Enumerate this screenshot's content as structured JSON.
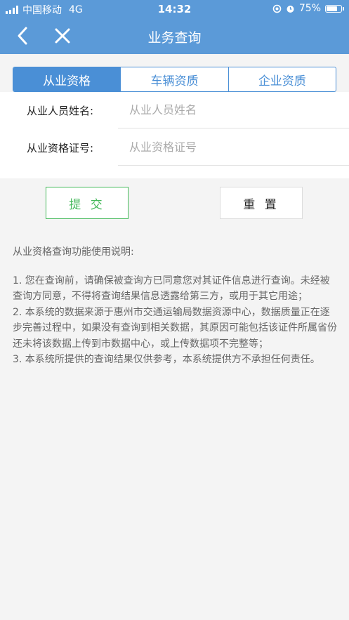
{
  "status_bar": {
    "carrier": "中国移动",
    "network": "4G",
    "time": "14:32",
    "battery": "75%"
  },
  "nav": {
    "title": "业务查询",
    "back_icon": "chevron-left-icon",
    "close_icon": "close-icon"
  },
  "tabs": [
    {
      "label": "从业资格",
      "active": true
    },
    {
      "label": "车辆资质",
      "active": false
    },
    {
      "label": "企业资质",
      "active": false
    }
  ],
  "form": {
    "name": {
      "label": "从业人员姓名:",
      "placeholder": "从业人员姓名",
      "value": ""
    },
    "cert": {
      "label": "从业资格证号:",
      "placeholder": "从业资格证号",
      "value": ""
    }
  },
  "buttons": {
    "submit": "提 交",
    "reset": "重 置"
  },
  "instructions": {
    "heading": "从业资格查询功能使用说明:",
    "items": [
      "1. 您在查询前，请确保被查询方已同意您对其证件信息进行查询。未经被查询方同意，不得将查询结果信息透露给第三方，或用于其它用途；",
      "2. 本系统的数据来源于惠州市交通运输局数据资源中心，数据质量正在逐步完善过程中，如果没有查询到相关数据，其原因可能包括该证件所属省份还未将该数据上传到市数据中心，或上传数据项不完整等；",
      "3. 本系统所提供的查询结果仅供参考，本系统提供方不承担任何责任。"
    ]
  },
  "colors": {
    "header": "#5b9ad8",
    "tab_accent": "#4a8fd6",
    "submit": "#44b95a"
  }
}
